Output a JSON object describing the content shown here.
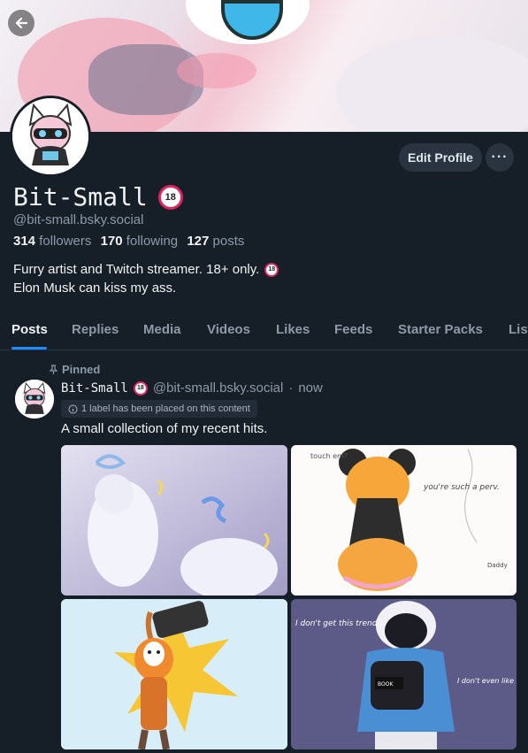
{
  "profile": {
    "display_name": "Bit-Small",
    "adult_badge": "18",
    "handle": "@bit-small.bsky.social",
    "followers_count": "314",
    "followers_label": "followers",
    "following_count": "170",
    "following_label": "following",
    "posts_count": "127",
    "posts_label": "posts",
    "bio_line1": "Furry artist and Twitch streamer. 18+ only.",
    "bio_line2": "Elon Musk can kiss my ass."
  },
  "actions": {
    "edit_profile": "Edit Profile",
    "more": "···"
  },
  "tabs": [
    "Posts",
    "Replies",
    "Media",
    "Videos",
    "Likes",
    "Feeds",
    "Starter Packs",
    "Lists"
  ],
  "post": {
    "pinned_label": "Pinned",
    "author_name": "Bit-Small",
    "author_handle": "@bit-small.bsky.social",
    "separator": "·",
    "time": "now",
    "content_label": "1 label has been placed on this content",
    "text": "A small collection of my recent hits."
  },
  "image_texts": {
    "img2_a": "touch em?",
    "img2_b": "you're such a perv.",
    "img2_c": "Daddy",
    "img4_a": "I don't get this trend...",
    "img4_b": "I don't even like books...",
    "img4_c": "BOOK"
  },
  "colors": {
    "background": "#161e27",
    "accent": "#1f8bff",
    "muted_text": "#8d9aa8",
    "button_bg": "#2a3441"
  },
  "icons": {
    "back": "arrow-left-icon",
    "pin": "pin-icon",
    "info": "info-circle-icon",
    "more": "ellipsis-icon"
  }
}
